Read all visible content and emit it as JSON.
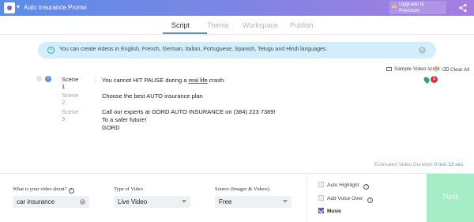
{
  "header": {
    "title": "Auto Insurance Promo",
    "upgrade_line1": "Upgrade to",
    "upgrade_line2": "Premium"
  },
  "steps": [
    {
      "label": "Script",
      "active": true
    },
    {
      "label": "Theme",
      "active": false
    },
    {
      "label": "Workspace",
      "active": false
    },
    {
      "label": "Publish",
      "active": false
    }
  ],
  "info_banner": {
    "text": "You can create videos in English, French, German, Italian, Portuguese, Spanish, Telugu and Hindi languages."
  },
  "toolbar": {
    "sample_label": "Sample Video script",
    "clear_label": "Clear All"
  },
  "scenes": [
    {
      "label": "Scene 1",
      "active": true
    },
    {
      "label": "Scene 2",
      "active": false
    },
    {
      "label": "Scene 3",
      "active": false
    }
  ],
  "script": {
    "scene1_pre": "You cannot HIT PAUSE during a ",
    "scene1_marked": "real life",
    "scene1_post": " crash.",
    "scene2": "Choose the best AUTO insurance plan",
    "scene3_line1": "Call our experts at GORD AUTO INSURANCE on (384) 223 7389!",
    "scene3_line2": "To a safer future!",
    "scene3_line3": "GORD"
  },
  "issues_badge": "1",
  "duration": {
    "label": "Estimated Video Duration",
    "value": "0 min 13 sec"
  },
  "form": {
    "about_label": "What is your video about?",
    "about_value": "car insurance",
    "type_label": "Type of Video",
    "type_value": "Live Video",
    "source_label": "Source (Images & Videos)",
    "source_value": "Free"
  },
  "options": {
    "auto_highlight": "Auto Highlight",
    "voice_over": "Add Voice Over",
    "music": "Music"
  },
  "next_label": "Next",
  "colors": {
    "accent": "#5b8ee6",
    "next_button": "#a6ecc6",
    "music_check": "#7a4fd0",
    "banner_bg": "#d2eef9"
  }
}
